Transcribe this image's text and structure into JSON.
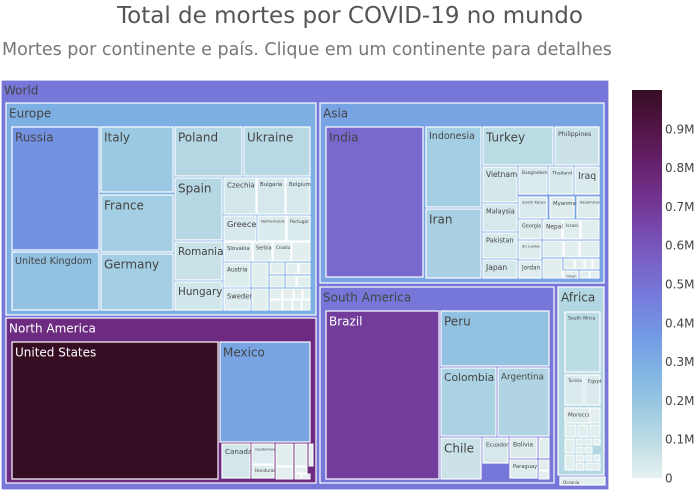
{
  "chart_data": {
    "type": "treemap",
    "title": "Total de mortes por COVID-19 no mundo",
    "subtitle": "Mortes por continente e país. Clique em um continente para detalhes",
    "colorscale": [
      "#e6f0f0",
      "#bfdde5",
      "#9cc9e2",
      "#81b4e3",
      "#739ae4",
      "#757fdd",
      "#7864ca",
      "#774aaf",
      "#71328d",
      "#641f68",
      "#501442",
      "#360e24"
    ],
    "colorbar": {
      "min": 0,
      "max": 1000000,
      "ticks": [
        0,
        100000,
        200000,
        300000,
        400000,
        500000,
        600000,
        700000,
        800000,
        900000
      ],
      "tick_labels": [
        "0",
        "0.1M",
        "0.2M",
        "0.3M",
        "0.4M",
        "0.5M",
        "0.6M",
        "0.7M",
        "0.8M",
        "0.9M"
      ]
    },
    "nodes": [
      {
        "label": "World",
        "parent": "",
        "deaths": 480000
      },
      {
        "label": "Europe",
        "parent": "World",
        "deaths": 290000
      },
      {
        "label": "Asia",
        "parent": "World",
        "deaths": 330000
      },
      {
        "label": "North America",
        "parent": "World",
        "deaths": 760000
      },
      {
        "label": "South America",
        "parent": "World",
        "deaths": 480000
      },
      {
        "label": "Africa",
        "parent": "World",
        "deaths": 120000
      },
      {
        "label": "Oceania",
        "parent": "World",
        "deaths": 10000
      },
      {
        "label": "Russia",
        "parent": "Europe",
        "deaths": 390000
      },
      {
        "label": "United Kingdom",
        "parent": "Europe",
        "deaths": 215000
      },
      {
        "label": "Italy",
        "parent": "Europe",
        "deaths": 185000
      },
      {
        "label": "France",
        "parent": "Europe",
        "deaths": 160000
      },
      {
        "label": "Germany",
        "parent": "Europe",
        "deaths": 160000
      },
      {
        "label": "Poland",
        "parent": "Europe",
        "deaths": 118000
      },
      {
        "label": "Ukraine",
        "parent": "Europe",
        "deaths": 110000
      },
      {
        "label": "Spain",
        "parent": "Europe",
        "deaths": 115000
      },
      {
        "label": "Romania",
        "parent": "Europe",
        "deaths": 67000
      },
      {
        "label": "Hungary",
        "parent": "Europe",
        "deaths": 48000
      },
      {
        "label": "Czechia",
        "parent": "Europe",
        "deaths": 42000
      },
      {
        "label": "Bulgaria",
        "parent": "Europe",
        "deaths": 38000
      },
      {
        "label": "Belgium",
        "parent": "Europe",
        "deaths": 33000
      },
      {
        "label": "Greece",
        "parent": "Europe",
        "deaths": 34000
      },
      {
        "label": "Netherlands",
        "parent": "Europe",
        "deaths": 23000
      },
      {
        "label": "Portugal",
        "parent": "Europe",
        "deaths": 25000
      },
      {
        "label": "Slovakia",
        "parent": "Europe",
        "deaths": 20000
      },
      {
        "label": "Serbia",
        "parent": "Europe",
        "deaths": 17000
      },
      {
        "label": "Croatia",
        "parent": "Europe",
        "deaths": 16000
      },
      {
        "label": "Austria",
        "parent": "Europe",
        "deaths": 21000
      },
      {
        "label": "Sweden",
        "parent": "Europe",
        "deaths": 20000
      },
      {
        "label": "India",
        "parent": "Asia",
        "deaths": 530000
      },
      {
        "label": "Indonesia",
        "parent": "Asia",
        "deaths": 160000
      },
      {
        "label": "Iran",
        "parent": "Asia",
        "deaths": 145000
      },
      {
        "label": "Turkey",
        "parent": "Asia",
        "deaths": 101000
      },
      {
        "label": "Philippines",
        "parent": "Asia",
        "deaths": 66000
      },
      {
        "label": "Vietnam",
        "parent": "Asia",
        "deaths": 43000
      },
      {
        "label": "Malaysia",
        "parent": "Asia",
        "deaths": 36000
      },
      {
        "label": "Pakistan",
        "parent": "Asia",
        "deaths": 30000
      },
      {
        "label": "Japan",
        "parent": "Asia",
        "deaths": 40000
      },
      {
        "label": "Bangladesh",
        "parent": "Asia",
        "deaths": 29000
      },
      {
        "label": "Thailand",
        "parent": "Asia",
        "deaths": 33000
      },
      {
        "label": "Iraq",
        "parent": "Asia",
        "deaths": 25000
      },
      {
        "label": "South Korea",
        "parent": "Asia",
        "deaths": 25000
      },
      {
        "label": "Myanmar",
        "parent": "Asia",
        "deaths": 19000
      },
      {
        "label": "Kazakhstan",
        "parent": "Asia",
        "deaths": 19000
      },
      {
        "label": "Georgia",
        "parent": "Asia",
        "deaths": 17000
      },
      {
        "label": "Nepal",
        "parent": "Asia",
        "deaths": 12000
      },
      {
        "label": "Israel",
        "parent": "Asia",
        "deaths": 11000
      },
      {
        "label": "Sri Lanka",
        "parent": "Asia",
        "deaths": 16000
      },
      {
        "label": "Jordan",
        "parent": "Asia",
        "deaths": 14000
      },
      {
        "label": "Oman",
        "parent": "Asia",
        "deaths": 4600
      },
      {
        "label": "United States",
        "parent": "North America",
        "deaths": 1000000
      },
      {
        "label": "Mexico",
        "parent": "North America",
        "deaths": 330000
      },
      {
        "label": "Canada",
        "parent": "North America",
        "deaths": 45000
      },
      {
        "label": "Guatemala",
        "parent": "North America",
        "deaths": 20000
      },
      {
        "label": "Honduras",
        "parent": "North America",
        "deaths": 11000
      },
      {
        "label": "Brazil",
        "parent": "South America",
        "deaths": 690000
      },
      {
        "label": "Peru",
        "parent": "South America",
        "deaths": 216000
      },
      {
        "label": "Colombia",
        "parent": "South America",
        "deaths": 142000
      },
      {
        "label": "Argentina",
        "parent": "South America",
        "deaths": 130000
      },
      {
        "label": "Chile",
        "parent": "South America",
        "deaths": 62000
      },
      {
        "label": "Ecuador",
        "parent": "South America",
        "deaths": 36000
      },
      {
        "label": "Bolivia",
        "parent": "South America",
        "deaths": 22000
      },
      {
        "label": "Paraguay",
        "parent": "South America",
        "deaths": 19000
      },
      {
        "label": "South Africa",
        "parent": "Africa",
        "deaths": 102000
      },
      {
        "label": "Tunisia",
        "parent": "Africa",
        "deaths": 29000
      },
      {
        "label": "Egypt",
        "parent": "Africa",
        "deaths": 25000
      },
      {
        "label": "Morocco",
        "parent": "Africa",
        "deaths": 16000
      }
    ]
  }
}
